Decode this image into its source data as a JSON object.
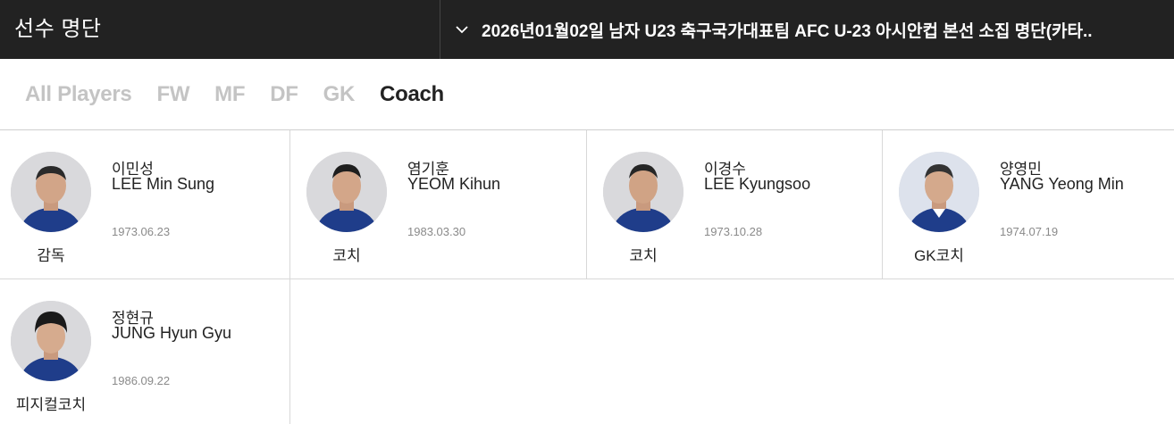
{
  "header": {
    "title": "선수 명단",
    "selector_label": "2026년01월02일 남자 U23 축구국가대표팀 AFC U-23 아시안컵 본선 소집 명단(카타.."
  },
  "tabs": [
    {
      "label": "All Players",
      "active": false
    },
    {
      "label": "FW",
      "active": false
    },
    {
      "label": "MF",
      "active": false
    },
    {
      "label": "DF",
      "active": false
    },
    {
      "label": "GK",
      "active": false
    },
    {
      "label": "Coach",
      "active": true
    }
  ],
  "staff": [
    {
      "name_ko": "이민성",
      "name_en": "LEE Min Sung",
      "dob": "1973.06.23",
      "role": "감독"
    },
    {
      "name_ko": "염기훈",
      "name_en": "YEOM Kihun",
      "dob": "1983.03.30",
      "role": "코치"
    },
    {
      "name_ko": "이경수",
      "name_en": "LEE Kyungsoo",
      "dob": "1973.10.28",
      "role": "코치"
    },
    {
      "name_ko": "양영민",
      "name_en": "YANG Yeong Min",
      "dob": "1974.07.19",
      "role": "GK코치"
    },
    {
      "name_ko": "정현규",
      "name_en": "JUNG Hyun Gyu",
      "dob": "1986.09.22",
      "role": "피지컬코치"
    }
  ],
  "colors": {
    "header_bg": "#222222",
    "active_tab": "#222222",
    "inactive_tab": "#c4c4c4",
    "kit_blue": "#1f3d8a"
  },
  "icons": {
    "selector_icon": "chevron-down-icon",
    "photo_icon": "person-photo-icon"
  }
}
